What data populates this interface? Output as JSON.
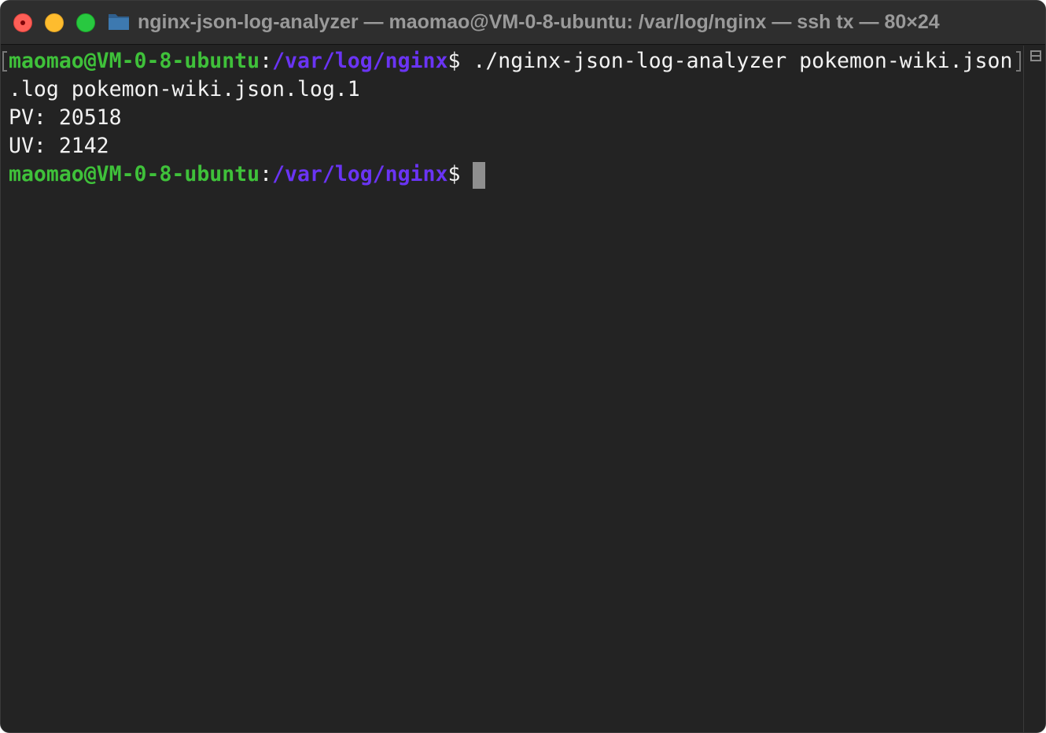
{
  "window": {
    "title": "nginx-json-log-analyzer — maomao@VM-0-8-ubuntu: /var/log/nginx — ssh tx — 80×24",
    "controls": [
      "close",
      "minimize",
      "zoom"
    ],
    "proxy_icon": "folder-icon"
  },
  "terminal": {
    "prompt_user": "maomao@VM-0-8-ubuntu",
    "prompt_colon": ":",
    "prompt_path": "/var/log/nginx",
    "prompt_sign": "$",
    "command_line_1": " ./nginx-json-log-analyzer pokemon-wiki.json",
    "command_line_2": ".log pokemon-wiki.json.log.1",
    "output_pv": "PV: 20518",
    "output_uv": "UV: 2142"
  },
  "colors": {
    "prompt_user": "#3fc13a",
    "prompt_path": "#6a34f4",
    "background": "#232323",
    "text": "#f2f2f2"
  }
}
